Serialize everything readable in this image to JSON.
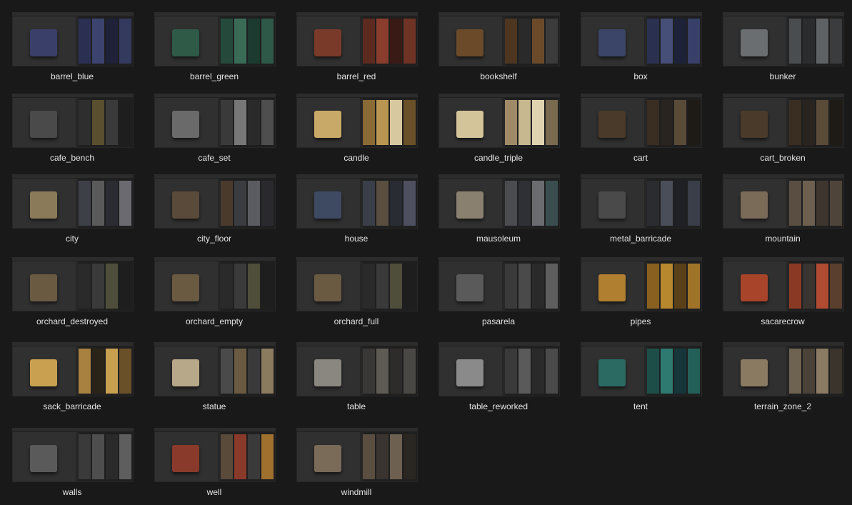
{
  "items": [
    {
      "name": "barrel_blue",
      "accent": "#3a3f6a",
      "tex": [
        "#2b2f52",
        "#3d436f",
        "#1e2138",
        "#34395e"
      ]
    },
    {
      "name": "barrel_green",
      "accent": "#2f5a48",
      "tex": [
        "#254a3b",
        "#3a6b56",
        "#1c3a2f",
        "#2e5847"
      ]
    },
    {
      "name": "barrel_red",
      "accent": "#7a3a2a",
      "tex": [
        "#5c2a1f",
        "#8a3d2c",
        "#3a1a14",
        "#6e3325"
      ]
    },
    {
      "name": "bookshelf",
      "accent": "#6b4a2a",
      "tex": [
        "#4d3520",
        "#2a2a2a",
        "#6b4a2a",
        "#3b3b3b"
      ]
    },
    {
      "name": "box",
      "accent": "#3b4568",
      "tex": [
        "#2a3050",
        "#454f78",
        "#1e2238",
        "#38406a"
      ]
    },
    {
      "name": "bunker",
      "accent": "#6a6e70",
      "tex": [
        "#4a4d50",
        "#2a2c2e",
        "#5e6264",
        "#3a3c3e"
      ]
    },
    {
      "name": "cafe_bench",
      "accent": "#4a4a4a",
      "tex": [
        "#2e2e2e",
        "#5a4f2e",
        "#3a3a3a",
        "#1e1e1e"
      ]
    },
    {
      "name": "cafe_set",
      "accent": "#6a6a6a",
      "tex": [
        "#3a3a3a",
        "#777777",
        "#2a2a2a",
        "#4e4e4e"
      ]
    },
    {
      "name": "candle",
      "accent": "#c8a968",
      "tex": [
        "#8a6a35",
        "#b89550",
        "#d8c8a0",
        "#6a5028"
      ]
    },
    {
      "name": "candle_triple",
      "accent": "#d4c49a",
      "tex": [
        "#a08a68",
        "#c8b890",
        "#e0d4b0",
        "#7a6a50"
      ]
    },
    {
      "name": "cart",
      "accent": "#4a3a2a",
      "tex": [
        "#3a2e22",
        "#2a2420",
        "#5a4a38",
        "#1e1a16"
      ]
    },
    {
      "name": "cart_broken",
      "accent": "#4a3a2a",
      "tex": [
        "#3a2e22",
        "#2a2420",
        "#5a4a38",
        "#1e1a16"
      ]
    },
    {
      "name": "city",
      "accent": "#8a7a5a",
      "tex": [
        "#3e4048",
        "#5a5a5a",
        "#2a2c32",
        "#6a6a70"
      ]
    },
    {
      "name": "city_floor",
      "accent": "#5a4a3a",
      "tex": [
        "#4a3a2c",
        "#3a3c40",
        "#5a5c62",
        "#2a2a2e"
      ]
    },
    {
      "name": "house",
      "accent": "#3e4a62",
      "tex": [
        "#3a3e48",
        "#5a4e40",
        "#2a2c34",
        "#4e5060"
      ]
    },
    {
      "name": "mausoleum",
      "accent": "#8a8070",
      "tex": [
        "#4a4c50",
        "#2e3036",
        "#6a6c70",
        "#3a4e50"
      ]
    },
    {
      "name": "metal_barricade",
      "accent": "#4a4a4a",
      "tex": [
        "#2a2c30",
        "#4a4e58",
        "#1e2024",
        "#3a3e48"
      ]
    },
    {
      "name": "mountain",
      "accent": "#7a6a58",
      "tex": [
        "#5a4e42",
        "#6e6050",
        "#3e362e",
        "#4e443a"
      ]
    },
    {
      "name": "orchard_destroyed",
      "accent": "#6a5a42",
      "tex": [
        "#2a2a2a",
        "#3a3a3a",
        "#4e4e3a",
        "#1e1e1e"
      ]
    },
    {
      "name": "orchard_empty",
      "accent": "#6a5a42",
      "tex": [
        "#2a2a2a",
        "#3a3a3a",
        "#4e4e3a",
        "#1e1e1e"
      ]
    },
    {
      "name": "orchard_full",
      "accent": "#6a5a42",
      "tex": [
        "#2a2a2a",
        "#3a3a3a",
        "#4e4e3a",
        "#1e1e1e"
      ]
    },
    {
      "name": "pasarela",
      "accent": "#5a5a5a",
      "tex": [
        "#3a3a3a",
        "#4a4a4a",
        "#2a2a2a",
        "#5e5e5e"
      ]
    },
    {
      "name": "pipes",
      "accent": "#b08030",
      "tex": [
        "#8a6020",
        "#b8882e",
        "#5a4018",
        "#a07428"
      ]
    },
    {
      "name": "sacarecrow",
      "accent": "#a8442a",
      "tex": [
        "#8a3a24",
        "#3a3430",
        "#b04a30",
        "#5a3e2e"
      ]
    },
    {
      "name": "sack_barricade",
      "accent": "#c8a050",
      "tex": [
        "#a88040",
        "#2a2418",
        "#c8a050",
        "#6a5028"
      ]
    },
    {
      "name": "statue",
      "accent": "#b8a88a",
      "tex": [
        "#4a4a4a",
        "#6a5a42",
        "#3a3a3a",
        "#8a7a5e"
      ]
    },
    {
      "name": "table",
      "accent": "#8a8680",
      "tex": [
        "#3a3836",
        "#5e5a54",
        "#2e2c2a",
        "#4a4844"
      ]
    },
    {
      "name": "table_reworked",
      "accent": "#8a8a8a",
      "tex": [
        "#3a3a3a",
        "#5a5a5a",
        "#2a2a2a",
        "#4a4a4a"
      ]
    },
    {
      "name": "tent",
      "accent": "#2a6a62",
      "tex": [
        "#1e4e48",
        "#2e7a70",
        "#16363a",
        "#24605a"
      ]
    },
    {
      "name": "terrain_zone_2",
      "accent": "#8a7a62",
      "tex": [
        "#6e6250",
        "#4a4238",
        "#8a7a62",
        "#3a342c"
      ]
    },
    {
      "name": "walls",
      "accent": "#5a5a5a",
      "tex": [
        "#3a3a3a",
        "#4e4e4e",
        "#2a2a2a",
        "#5e5e5e"
      ]
    },
    {
      "name": "well",
      "accent": "#8a3a2a",
      "tex": [
        "#5a4a3a",
        "#8a3a2a",
        "#3a3a3a",
        "#a0702e"
      ]
    },
    {
      "name": "windmill",
      "accent": "#7a6a58",
      "tex": [
        "#5a4e40",
        "#3a3430",
        "#6e6050",
        "#2a2622"
      ]
    }
  ]
}
